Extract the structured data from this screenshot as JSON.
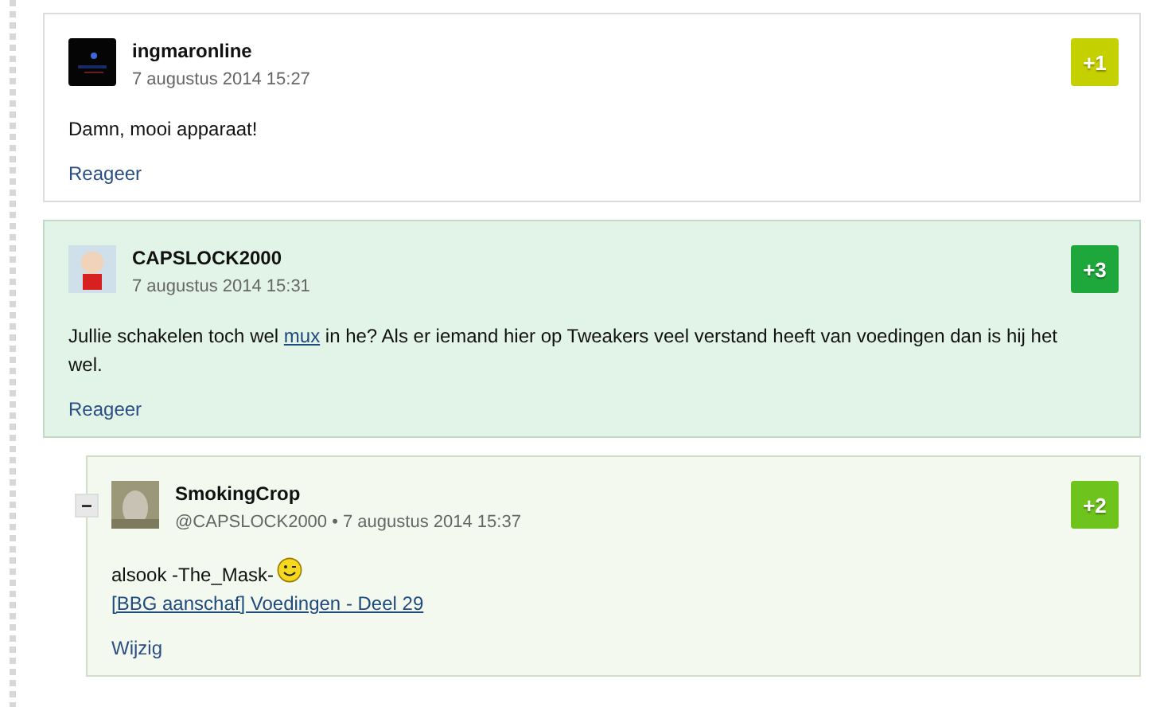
{
  "comments": [
    {
      "kind": "plain",
      "author": "ingmaronline",
      "meta": "7 augustus 2014 15:27",
      "score": "+1",
      "color": "#c4d000",
      "body": [
        {
          "kind": "text",
          "text": "Damn, mooi apparaat!"
        }
      ],
      "action": "Reageer"
    },
    {
      "kind": "highlighted",
      "author": "CAPSLOCK2000",
      "meta": "7 augustus 2014 15:31",
      "score": "+3",
      "color": "#1ea83c",
      "body": [
        {
          "kind": "text",
          "text": "Jullie schakelen toch wel "
        },
        {
          "kind": "link",
          "text": "mux"
        },
        {
          "kind": "text",
          "text": " in he? Als er iemand hier op Tweakers veel verstand heeft van voedingen dan is hij het wel."
        }
      ],
      "action": "Reageer",
      "children": [
        {
          "kind": "own",
          "toggle": "–",
          "expanded": true,
          "author": "SmokingCrop",
          "meta": "@CAPSLOCK2000 • 7 augustus 2014 15:37",
          "score": "+2",
          "color": "#6ec41c",
          "body": [
            {
              "kind": "text",
              "text": "alsook -The_Mask-"
            },
            {
              "kind": "smiley"
            },
            {
              "kind": "break"
            },
            {
              "kind": "link",
              "text": "[BBG aanschaf] Voedingen - Deel 29"
            }
          ],
          "action": "Wijzig"
        }
      ]
    }
  ]
}
